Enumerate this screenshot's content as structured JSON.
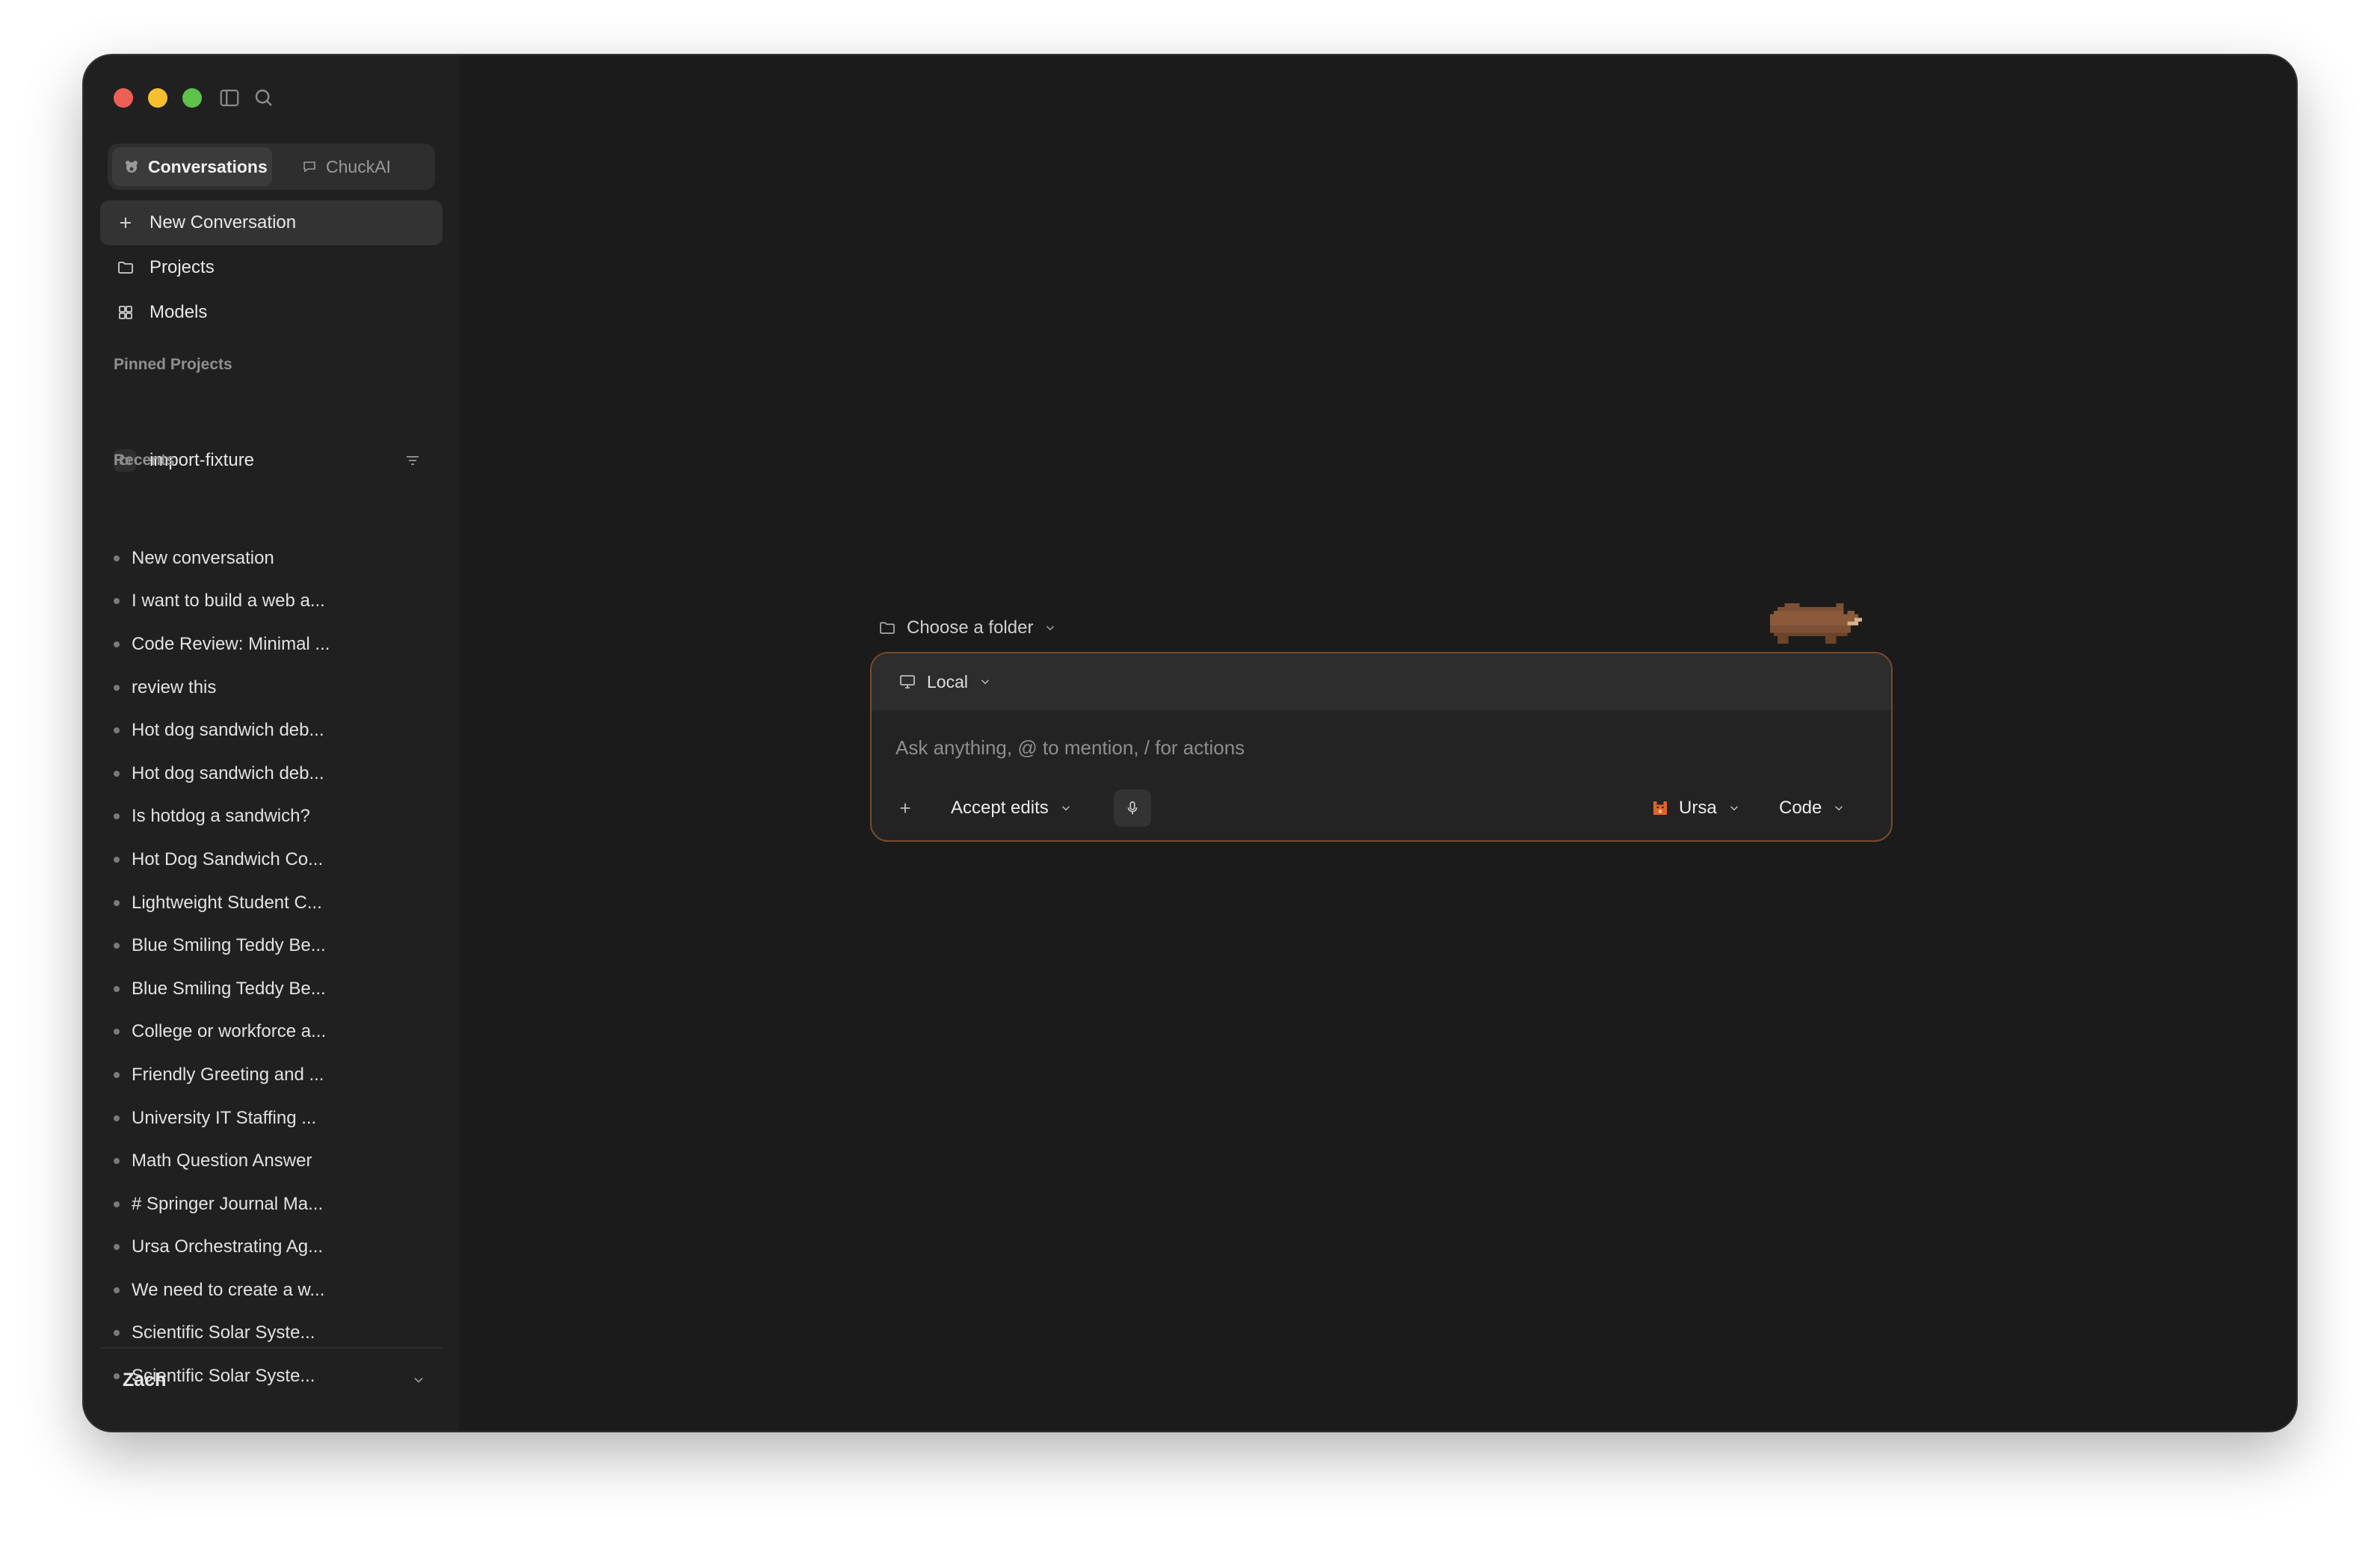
{
  "sidebar": {
    "tabs": [
      {
        "label": "Conversations",
        "active": true
      },
      {
        "label": "ChuckAI",
        "active": false
      }
    ],
    "nav": {
      "new_conversation": "New Conversation",
      "projects": "Projects",
      "models": "Models"
    },
    "pinned": {
      "heading": "Pinned Projects",
      "items": [
        "import-fixture"
      ]
    },
    "recents": {
      "heading": "Recents",
      "items": [
        "New conversation",
        "I want to build a web a...",
        "Code Review: Minimal ...",
        "review this",
        "Hot dog sandwich deb...",
        "Hot dog sandwich deb...",
        "Is hotdog a sandwich?",
        "Hot Dog Sandwich Co...",
        "Lightweight Student C...",
        "Blue Smiling Teddy Be...",
        "Blue Smiling Teddy Be...",
        "College or workforce a...",
        "Friendly Greeting and ...",
        "University IT Staffing ...",
        "Math Question Answer",
        "# Springer Journal Ma...",
        "Ursa Orchestrating Ag...",
        "We need to create a w...",
        "Scientific Solar Syste...",
        "Scientific Solar Syste..."
      ]
    },
    "user": {
      "name": "Zach"
    }
  },
  "composer": {
    "folder_label": "Choose a folder",
    "environment": "Local",
    "placeholder": "Ask anything, @ to mention, / for actions",
    "permission_mode": "Accept edits",
    "agent": "Ursa",
    "mode": "Code"
  },
  "colors": {
    "window_bg": "#1b1b1b",
    "sidebar_bg": "#202020",
    "composer_border": "#7a4a2c",
    "accent_red": "#ee5f57",
    "accent_yellow": "#f5bf2f",
    "accent_green": "#5fc24a"
  },
  "icons": {
    "sidebar_toggle": "sidebar-toggle-icon",
    "search": "search-icon",
    "plus": "plus-icon",
    "folder": "folder-icon",
    "grid": "grid-icon",
    "filter": "filter-icon",
    "monitor": "monitor-icon",
    "microphone": "microphone-icon",
    "chevron": "chevron-down-icon"
  }
}
